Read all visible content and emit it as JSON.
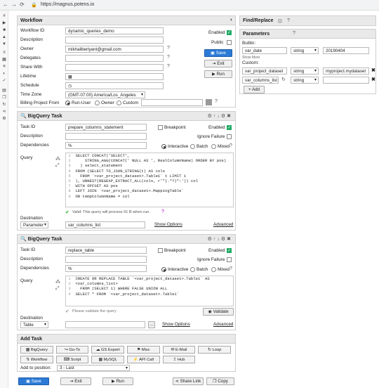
{
  "browser": {
    "url": "https://magnus.potens.io"
  },
  "workflow": {
    "title": "Workflow",
    "labels": {
      "id": "Workflow ID",
      "desc": "Description",
      "owner": "Owner",
      "delegates": "Delegates",
      "share": "Share With",
      "lifetime": "Lifetime",
      "schedule": "Schedule",
      "tz": "Time Zone",
      "billing": "Billing Project From"
    },
    "id_value": "dynamic_queries_demo",
    "owner_value": "mikhailberlyant@gmail.com",
    "tz_value": "(GMT-07:00) America/Los_Angeles",
    "billing_options": [
      "Run-User",
      "Owner",
      "Custom"
    ],
    "enabled_label": "Enabled",
    "public_label": "Public",
    "save_label": "Save",
    "exit_label": "Exit",
    "run_label": "Run"
  },
  "findreplace": {
    "title": "Find/Replace"
  },
  "params": {
    "title": "Parameters",
    "builtin_label": "Builtin:",
    "show_more": "Show More",
    "custom_label": "Custom:",
    "add_label": "Add",
    "rows": [
      {
        "name": "var_date",
        "type": "string",
        "value": "20190404"
      },
      {
        "name": "var_project_dataset",
        "type": "string",
        "value": "myproject.mydataset"
      },
      {
        "name": "var_columns_list",
        "type": "string",
        "value": ""
      }
    ]
  },
  "task1": {
    "title": "BigQuery Task",
    "labels": {
      "id": "Task ID",
      "desc": "Description",
      "deps": "Dependencies",
      "query": "Query",
      "dest": "Destination"
    },
    "id_value": "prepare_columns_statement",
    "deps_value": "%",
    "breakpoint": "Breakpoint",
    "enabled": "Enabled",
    "ignore": "Ignore Failure",
    "modes": [
      "Interactive",
      "Batch",
      "Mixed"
    ],
    "code": [
      "SELECT CONCAT('SELECT',",
      "    STRING_AGG(CONCAT(' NULL AS ', RealColumnName) ORDER BY pos)",
      "  ) select_statement",
      "FROM (SELECT TO_JSON_STRING(t) AS cols",
      "  FROM `<var_project_dataset>.Table1` t LIMIT 1",
      "), UNNEST(REGEXP_EXTRACT_ALL(cols, r'\"(.*?)\":')) col",
      "WITH OFFSET AS pos",
      "LEFT JOIN `<var_project_dataset>.MappingTable`",
      "ON tempColumnName = col"
    ],
    "valid_msg": "Valid: This query will process 91 B when run.",
    "dest_value": "Parameter",
    "dest_target": "var_columns_list",
    "show_options": "Show Options",
    "advanced": "Advanced"
  },
  "task2": {
    "title": "BigQuery Task",
    "labels": {
      "id": "Task ID",
      "desc": "Description",
      "deps": "Dependencies",
      "query": "Query",
      "dest": "Destination"
    },
    "id_value": "replace_table",
    "deps_value": "%",
    "breakpoint": "Breakpoint",
    "enabled": "Enabled",
    "ignore": "Ignore Failure",
    "modes": [
      "Interactive",
      "Batch",
      "Mixed"
    ],
    "code": [
      "CREATE OR REPLACE TABLE `<var_project_dataset>.Table1` AS",
      "<var_columns_list>",
      "  FROM (SELECT 1) WHERE FALSE UNION ALL",
      "SELECT * FROM `<var_project_dataset>.Table1`"
    ],
    "validate_msg": "Please validate the query",
    "validate_btn": "Validate",
    "dest_value": "Table",
    "show_options": "Show Options",
    "advanced": "Advanced"
  },
  "addtask": {
    "title": "Add Task",
    "row1": [
      "BigQuery",
      "Go-To",
      "GS Export",
      "Misc",
      "E-Mail",
      "Loop"
    ],
    "row2": [
      "Workflow",
      "Script",
      "MySQL",
      "API Call",
      "Hub"
    ],
    "position_label": "Add to position:",
    "position_value": "3 - Last"
  },
  "footer": {
    "save": "Save",
    "exit": "Exit",
    "run": "Run",
    "share": "Share Link",
    "copy": "Copy"
  }
}
